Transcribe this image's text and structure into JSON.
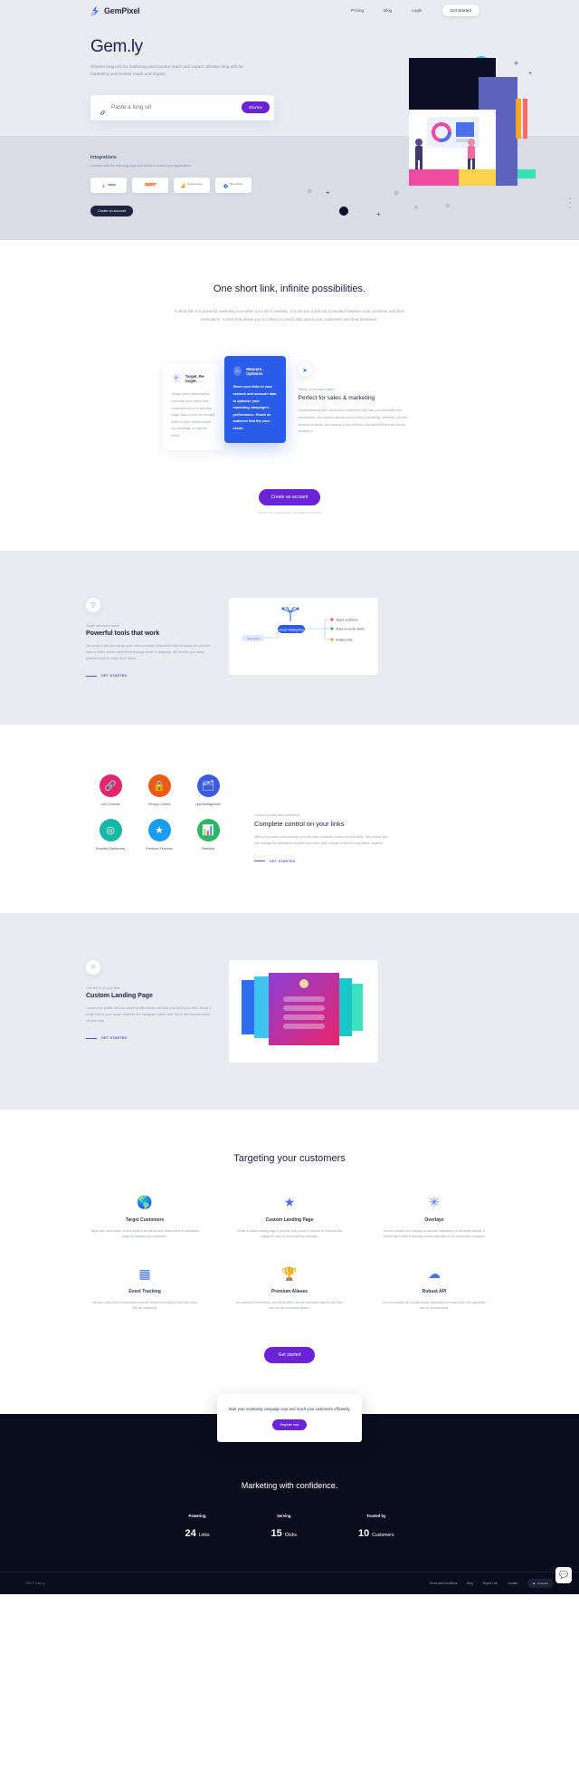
{
  "header": {
    "brand": "GemPixel",
    "logo_icon": "gem-logo-icon",
    "nav": [
      {
        "label": "Pricing"
      },
      {
        "label": "Blog"
      },
      {
        "label": "Login"
      }
    ],
    "cta": "Get Started"
  },
  "hero": {
    "title": "Gem.ly",
    "subtitle": "Shorten long urls for marketing and monitor reach and impact. Shorten long urls for marketing and monitor reach and impact.",
    "input_placeholder": "Paste a long url",
    "input_value": "",
    "input_icon": "link-icon",
    "shorten_button": "Shorten",
    "integrations_title": "Integrations",
    "integrations_sub": "Connect with the following apps and others to extend your application.",
    "integrations": [
      {
        "name": "slack",
        "icon": "slack-icon"
      },
      {
        "name": "zapier",
        "icon": "zapier-icon"
      },
      {
        "name": "Google Analytics",
        "icon": "google-analytics-icon"
      },
      {
        "name": "Bitly Analytics",
        "icon": "bitly-icon"
      }
    ],
    "account_button": "Create an account",
    "illustration": "marketing-dashboard-illustration"
  },
  "possibilities": {
    "title": "One short link, infinite possibilities.",
    "paragraph": "A short link is a powerful marketing tool when you use it carefully. It is not just a link but a medium between your customer and their destination. A short link allows you to collect so much data about your customers and their behaviors.",
    "cards": [
      {
        "icon": "target-icon",
        "title": "Target. Re-target.",
        "body": "Target your customers to increase your reach and redirect them to a relevant page. Add a pixel to retarget them in your social media ad campaign to capture them."
      },
      {
        "icon": "measure-icon",
        "title": "Measure. Optimize.",
        "body": "Share your links to your network and measure data to optimize your marketing campaign's performance. Reach an audience that fits your needs."
      }
    ],
    "feature": {
      "icon": "rocket-icon",
      "kicker": "Reach & increase sales.",
      "title": "Perfect for sales & marketing",
      "body": "Understanding your users and customers will help you increase your conversion. Our system allows you to track everything. Whether it is the amount of clicks, the country or the referrer, the data is there for you to analyze it."
    },
    "cta_button": "Create an account",
    "cta_note": "Start for free, upgrade later - No credit card required"
  },
  "tools": {
    "icon": "funnel-icon",
    "kicker": "Target interested users",
    "title": "Powerful tools that work",
    "body": "Our product lets your target your users to better understand their behavior and provide them a better overall experience through smart re-targeting. We provide you many powerful tools to reach them better.",
    "link": "GET STARTED",
    "diagram": {
      "icon": "funnel-diagram-icon",
      "center": "Smart Retargeting",
      "left": "Short links",
      "nodes": [
        "Target customers",
        "Share on social media",
        "Analyze data"
      ]
    }
  },
  "features_grid": {
    "items": [
      {
        "label": "Link Controls",
        "icon": "link-controls-icon",
        "color": "#e8246b"
      },
      {
        "label": "Privacy Control",
        "icon": "privacy-control-icon",
        "color": "#f05a14"
      },
      {
        "label": "Link Management",
        "icon": "link-management-icon",
        "color": "#3b5cde"
      },
      {
        "label": "Powerful Dashboard",
        "icon": "dashboard-icon",
        "color": "#17b6a5"
      },
      {
        "label": "Premium Features",
        "icon": "premium-star-icon",
        "color": "#1a9df0"
      },
      {
        "label": "Statistics",
        "icon": "statistics-icon",
        "color": "#2fb463"
      }
    ],
    "kicker": "Control on each and everything.",
    "title": "Complete control on your links",
    "body": "With our premium membership, you will have complete control on your links. This means you can change the destination anytime you want. Add, change or remove any filters, anytime.",
    "link": "GET STARTED"
  },
  "profile": {
    "icon": "user-circle-icon",
    "kicker": "One link to all your links",
    "title": "Custom Landing Page",
    "body": "Create your profile with our simple profile builder and add your all of your links. Share a single link on your social networks like instagram, twitter and TikTok and monitor clicks on your links.",
    "link": "GET STARTED",
    "preview": "public-profile-preview"
  },
  "targeting": {
    "title": "Targeting your customers",
    "items": [
      {
        "icon": "globe-icon",
        "title": "Target Customers",
        "desc": "Target your users based on their location and device and redirect them to specialized pages to increase your conversion."
      },
      {
        "icon": "star-icon",
        "title": "Custom Landing Page",
        "desc": "Create a custom landing page to promote your product or service on front-end and engage the user in your marketing campaign."
      },
      {
        "icon": "overlay-icon",
        "title": "Overlays",
        "desc": "Use our overlay tool to display unobtrusive notifications on the target website. A perfect way to send a message to your customers or run a promotion campaign."
      },
      {
        "icon": "grid-icon",
        "title": "Event Tracking",
        "desc": "Add your event pixel from providers such as Facebook and track events right when they are happening."
      },
      {
        "icon": "trophy-icon",
        "title": "Premium Aliases",
        "desc": "As a premium membership, you will be able to choose a premium alias for your links from our list of reserved aliases."
      },
      {
        "icon": "api-icon",
        "title": "Robust API",
        "desc": "Use our powerful API to build custom applications or extend your own application with our powerful tools."
      }
    ],
    "cta_button": "Get started"
  },
  "footer": {
    "promo_text": "Start your marketing campaign now and reach your customers efficiently.",
    "promo_button": "Register now",
    "headline": "Marketing with confidence.",
    "stats": [
      {
        "kicker": "Powering",
        "number": "24",
        "unit": "Links"
      },
      {
        "kicker": "Serving",
        "number": "15",
        "unit": "Clicks"
      },
      {
        "kicker": "Trusted by",
        "number": "10",
        "unit": "Customers"
      }
    ],
    "copyright": "2020 © Gem.ly",
    "links": [
      {
        "label": "Terms and Conditions"
      },
      {
        "label": "Blog"
      },
      {
        "label": "Report Link"
      },
      {
        "label": "Contact"
      }
    ],
    "badge": "Gempixel",
    "badge_icon": "gem-badge-icon",
    "chat_widget_icon": "chat-widget-icon"
  }
}
